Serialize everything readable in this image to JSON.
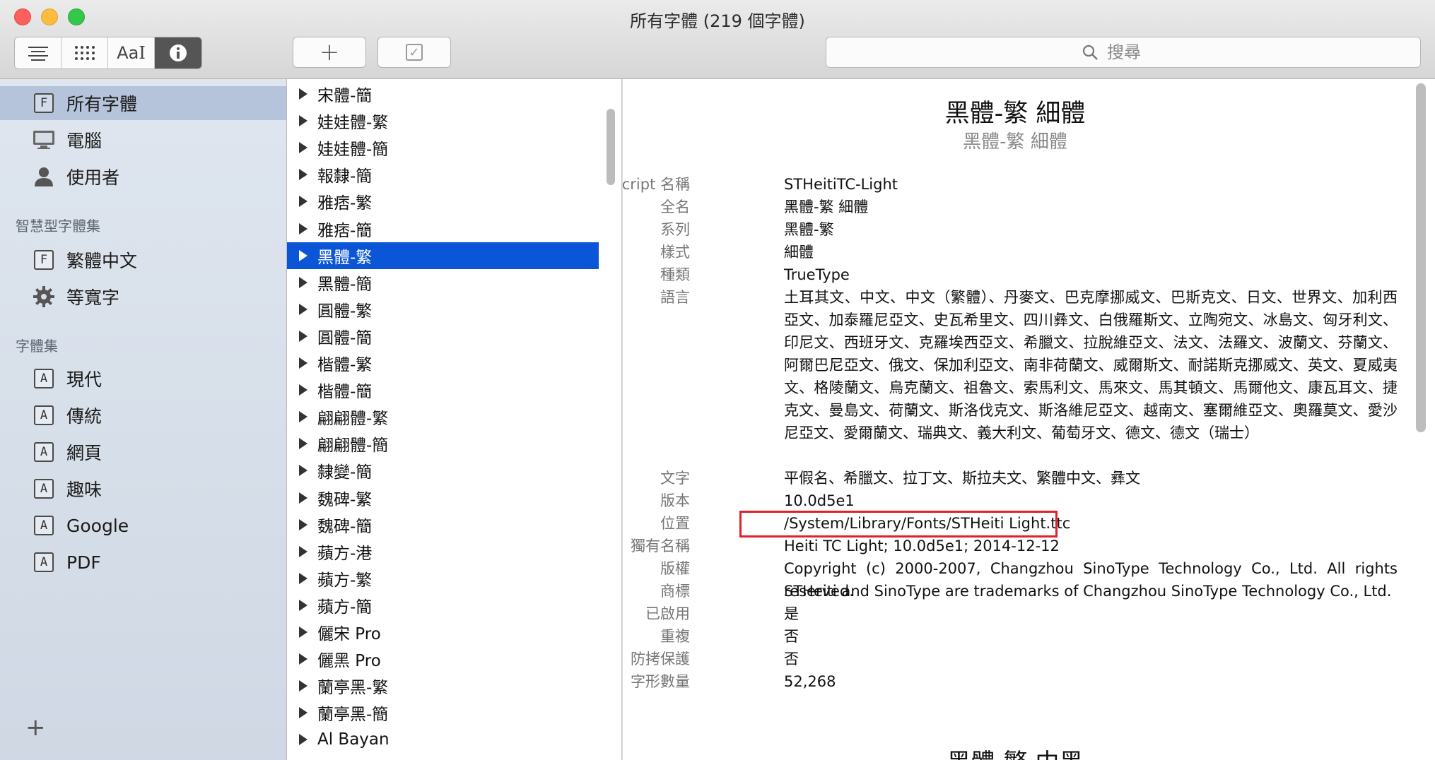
{
  "window": {
    "title": "所有字體 (219 個字體)"
  },
  "toolbar": {
    "view_buttons": [
      "list-icon",
      "grid-icon",
      "sample-text-icon",
      "info-icon"
    ],
    "sample_label": "Aa",
    "add_label": "+",
    "check_label": "✓",
    "search_placeholder": "搜尋"
  },
  "sidebar": {
    "items": [
      {
        "label": "所有字體",
        "icon": "F"
      },
      {
        "label": "電腦",
        "icon": "computer-icon"
      },
      {
        "label": "使用者",
        "icon": "user-icon"
      }
    ],
    "smart_header": "智慧型字體集",
    "smart_items": [
      {
        "label": "繁體中文",
        "icon": "F"
      },
      {
        "label": "等寬字",
        "icon": "gear-icon"
      }
    ],
    "collections_header": "字體集",
    "collections": [
      {
        "label": "現代",
        "icon": "A"
      },
      {
        "label": "傳統",
        "icon": "A"
      },
      {
        "label": "網頁",
        "icon": "A"
      },
      {
        "label": "趣味",
        "icon": "A"
      },
      {
        "label": "Google",
        "icon": "A"
      },
      {
        "label": "PDF",
        "icon": "A"
      }
    ],
    "add_label": "+"
  },
  "font_list": [
    "宋體-簡",
    "娃娃體-繁",
    "娃娃體-簡",
    "報隸-簡",
    "雅痞-繁",
    "雅痞-簡",
    "黑體-繁",
    "黑體-簡",
    "圓體-繁",
    "圓體-簡",
    "楷體-繁",
    "楷體-簡",
    "翩翩體-繁",
    "翩翩體-簡",
    "隸變-簡",
    "魏碑-繁",
    "魏碑-簡",
    "蘋方-港",
    "蘋方-繁",
    "蘋方-簡",
    "儷宋 Pro",
    "儷黑 Pro",
    "蘭亭黑-繁",
    "蘭亭黑-簡",
    "Al Bayan"
  ],
  "font_list_selected_index": 6,
  "detail": {
    "title": "黑體-繁 細體",
    "subtitle": "黑體-繁 細體",
    "rows": [
      {
        "label": "PostScript 名稱",
        "value": "STHeitiTC-Light"
      },
      {
        "label": "全名",
        "value": "黑體-繁 細體"
      },
      {
        "label": "系列",
        "value": "黑體-繁"
      },
      {
        "label": "樣式",
        "value": "細體"
      },
      {
        "label": "種類",
        "value": "TrueType"
      },
      {
        "label": "語言",
        "value": "土耳其文、中文、中文（繁體）、丹麥文、巴克摩挪威文、巴斯克文、日文、世界文、加利西亞文、加泰羅尼亞文、史瓦希里文、四川彝文、白俄羅斯文、立陶宛文、冰島文、匈牙利文、印尼文、西班牙文、克羅埃西亞文、希臘文、拉脫維亞文、法文、法羅文、波蘭文、芬蘭文、阿爾巴尼亞文、俄文、保加利亞文、南非荷蘭文、威爾斯文、耐諾斯克挪威文、英文、夏威夷文、格陵蘭文、烏克蘭文、祖魯文、索馬利文、馬來文、馬其頓文、馬爾他文、康瓦耳文、捷克文、曼島文、荷蘭文、斯洛伐克文、斯洛維尼亞文、越南文、塞爾維亞文、奧羅莫文、愛沙尼亞文、愛爾蘭文、瑞典文、義大利文、葡萄牙文、德文、德文（瑞士）"
      },
      {
        "label": "文字",
        "value": "平假名、希臘文、拉丁文、斯拉夫文、繁體中文、彝文"
      },
      {
        "label": "版本",
        "value": "10.0d5e1"
      },
      {
        "label": "位置",
        "value": "/System/Library/Fonts/STHeiti Light.ttc"
      },
      {
        "label": "獨有名稱",
        "value": "Heiti TC Light; 10.0d5e1; 2014-12-12"
      },
      {
        "label": "版權",
        "value": "Copyright (c) 2000-2007, Changzhou SinoType Technology Co., Ltd.  All rights reserved."
      },
      {
        "label": "商標",
        "value": "STHeiti and SinoType are trademarks of Changzhou SinoType Technology Co., Ltd."
      },
      {
        "label": "已啟用",
        "value": "是"
      },
      {
        "label": "重複",
        "value": "否"
      },
      {
        "label": "防拷保護",
        "value": "否"
      },
      {
        "label": "字形數量",
        "value": "52,268"
      }
    ],
    "next_title": "黑體-繁 中黑"
  },
  "colors": {
    "selection": "#0b56d6",
    "highlight_box": "#e0202a",
    "sidebar_selected": "#b5c4db"
  }
}
